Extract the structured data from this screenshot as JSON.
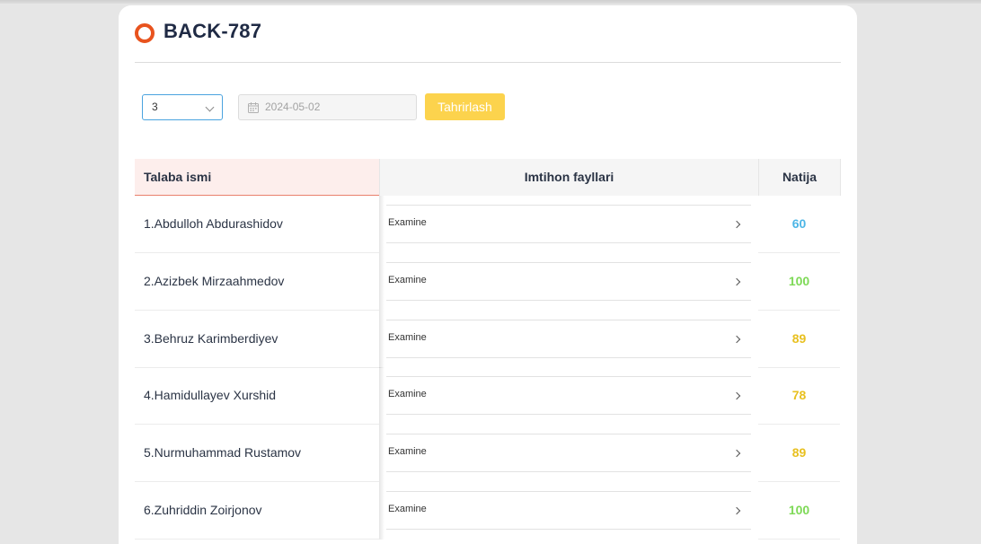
{
  "header": {
    "title": "BACK-787",
    "icon": "ring-icon",
    "icon_color": "#e8531e"
  },
  "controls": {
    "group_value": "3",
    "date_placeholder": "2024-05-02",
    "edit_label": "Tahrirlash"
  },
  "table": {
    "headers": {
      "name": "Talaba ismi",
      "files": "Imtihon fayllari",
      "result": "Natija"
    },
    "rows": [
      {
        "name": "1.Abdulloh Abdurashidov",
        "file": "Examine",
        "score": "60",
        "score_color": "#4db6e6"
      },
      {
        "name": "2.Azizbek Mirzaahmedov",
        "file": "Examine",
        "score": "100",
        "score_color": "#7ed957"
      },
      {
        "name": "3.Behruz Karimberdiyev",
        "file": "Examine",
        "score": "89",
        "score_color": "#e8c020"
      },
      {
        "name": "4.Hamidullayev Xurshid",
        "file": "Examine",
        "score": "78",
        "score_color": "#e8c020"
      },
      {
        "name": "5.Nurmuhammad Rustamov",
        "file": "Examine",
        "score": "89",
        "score_color": "#e8c020"
      },
      {
        "name": "6.Zuhriddin Zoirjonov",
        "file": "Examine",
        "score": "100",
        "score_color": "#7ed957"
      }
    ]
  }
}
